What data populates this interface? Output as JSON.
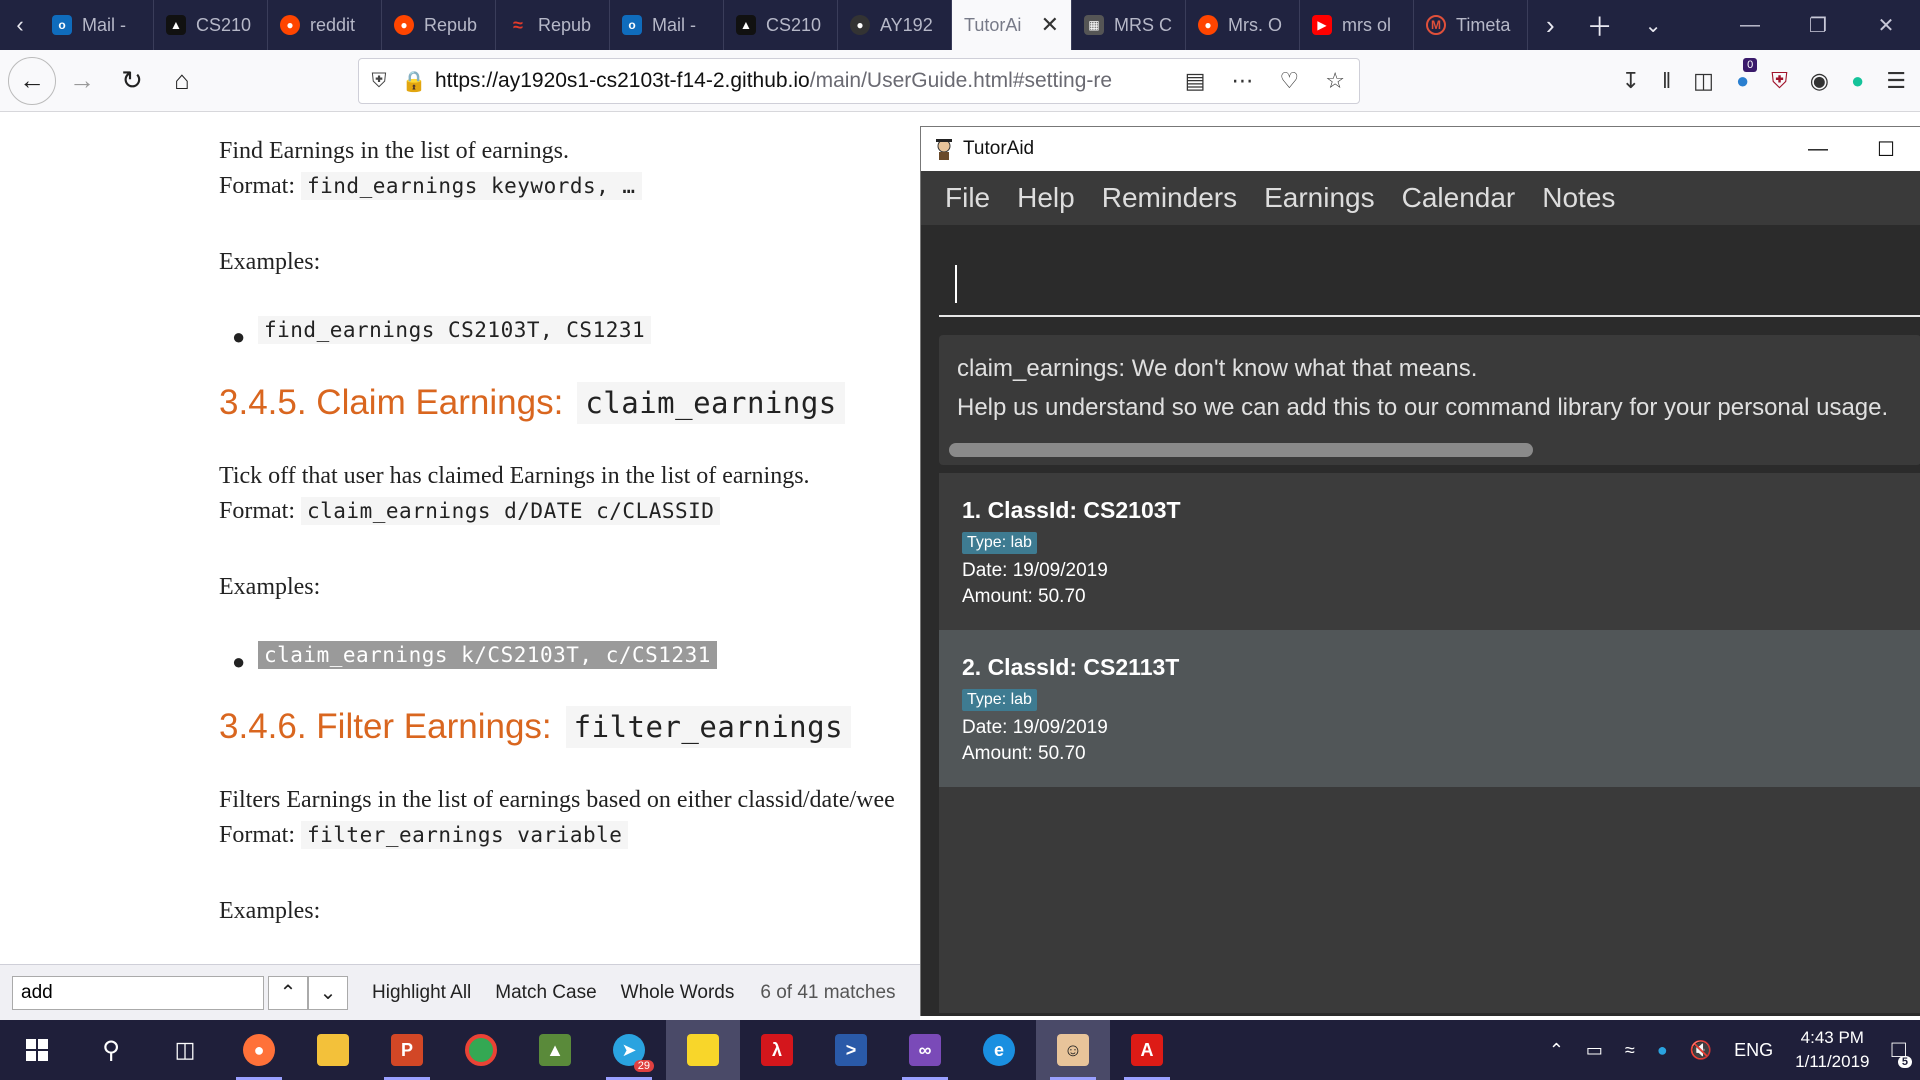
{
  "browser": {
    "tabs": [
      {
        "title": "Mail - ",
        "icon": "outlook-icon",
        "color": "#0f6cbd"
      },
      {
        "title": "CS210",
        "icon": "mortarboard-icon",
        "color": "#111111"
      },
      {
        "title": "reddit",
        "icon": "reddit-icon",
        "color": "#ff4500"
      },
      {
        "title": "Repub",
        "icon": "reddit-icon",
        "color": "#ff4500"
      },
      {
        "title": "Repub",
        "icon": "red-logo-icon",
        "color": "#e23a2a"
      },
      {
        "title": "Mail - ",
        "icon": "outlook-icon",
        "color": "#0f6cbd"
      },
      {
        "title": "CS210",
        "icon": "mortarboard-icon",
        "color": "#111111"
      },
      {
        "title": "AY192",
        "icon": "github-icon",
        "color": "#333333"
      },
      {
        "title": "TutorAi",
        "icon": "",
        "color": "",
        "active": true
      },
      {
        "title": "MRS C",
        "icon": "news-icon",
        "color": "#555555"
      },
      {
        "title": "Mrs. O",
        "icon": "reddit-icon",
        "color": "#ff4500"
      },
      {
        "title": "mrs ol",
        "icon": "youtube-icon",
        "color": "#ff0000"
      },
      {
        "title": "Timeta",
        "icon": "nusmods-icon",
        "color": "#e0503a"
      }
    ],
    "url_host": "https://ay1920s1-cs2103t-f14-2.github.io",
    "url_path": "/main/UserGuide.html#setting-re"
  },
  "doc": {
    "p1": "Find Earnings in the list of earnings.",
    "format_label": "Format:",
    "p1_format": "find_earnings keywords, …",
    "examples_label": "Examples:",
    "ex1": "find_earnings CS2103T, CS1231",
    "h_claim": "3.4.5. Claim Earnings:",
    "h_claim_code": "claim_earnings",
    "p2": "Tick off that user has claimed Earnings in the list of earnings.",
    "p2_format": "claim_earnings d/DATE c/CLASSID",
    "ex2": "claim_earnings k/CS2103T, c/CS1231",
    "h_filter": "3.4.6. Filter Earnings:",
    "h_filter_code": "filter_earnings",
    "p3": "Filters Earnings in the list of earnings based on either classid/date/wee",
    "p3_format": "filter_earnings variable"
  },
  "findbar": {
    "value": "add",
    "highlight_all": "Highlight All",
    "match_case": "Match Case",
    "whole_words": "Whole Words",
    "matches": "6 of 41 matches"
  },
  "app": {
    "title": "TutorAid",
    "menu": [
      "File",
      "Help",
      "Reminders",
      "Earnings",
      "Calendar",
      "Notes"
    ],
    "command_value": "",
    "result_line1": "claim_earnings: We don't know what that means.",
    "result_line2": "Help us understand so we can add this to our command library for your personal usage.",
    "earnings": [
      {
        "header": "1.  ClassId: CS2103T",
        "tag": "Type: lab",
        "date": "Date: 19/09/2019",
        "amount": "Amount: 50.70"
      },
      {
        "header": "2.  ClassId: CS2113T",
        "tag": "Type: lab",
        "date": "Date: 19/09/2019",
        "amount": "Amount: 50.70"
      }
    ]
  },
  "taskbar": {
    "telegram_count": "29",
    "lang": "ENG",
    "time": "4:43 PM",
    "date": "1/11/2019",
    "notifications": "5",
    "ext_badge": "0"
  }
}
